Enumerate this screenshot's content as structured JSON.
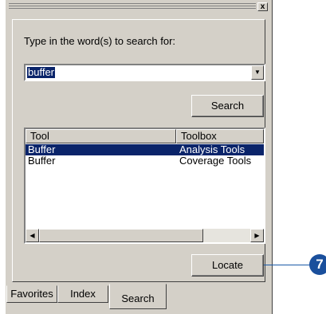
{
  "close_label": "x",
  "search_prompt": "Type in the word(s) to search for:",
  "search_value": "buffer",
  "search_button_label": "Search",
  "results": {
    "columns": [
      "Tool",
      "Toolbox"
    ],
    "rows": [
      {
        "tool": "Buffer",
        "toolbox": "Analysis Tools",
        "selected": true
      },
      {
        "tool": "Buffer",
        "toolbox": "Coverage Tools",
        "selected": false
      }
    ]
  },
  "locate_button_label": "Locate",
  "tabs": [
    "Favorites",
    "Index",
    "Search"
  ],
  "active_tab": "Search",
  "callout_number": "7",
  "icons": {
    "dropdown": "chevron-down-icon",
    "scroll_left": "arrow-left-icon",
    "scroll_right": "arrow-right-icon"
  },
  "colors": {
    "selection": "#0a246a",
    "callout": "#1a4f9c"
  }
}
